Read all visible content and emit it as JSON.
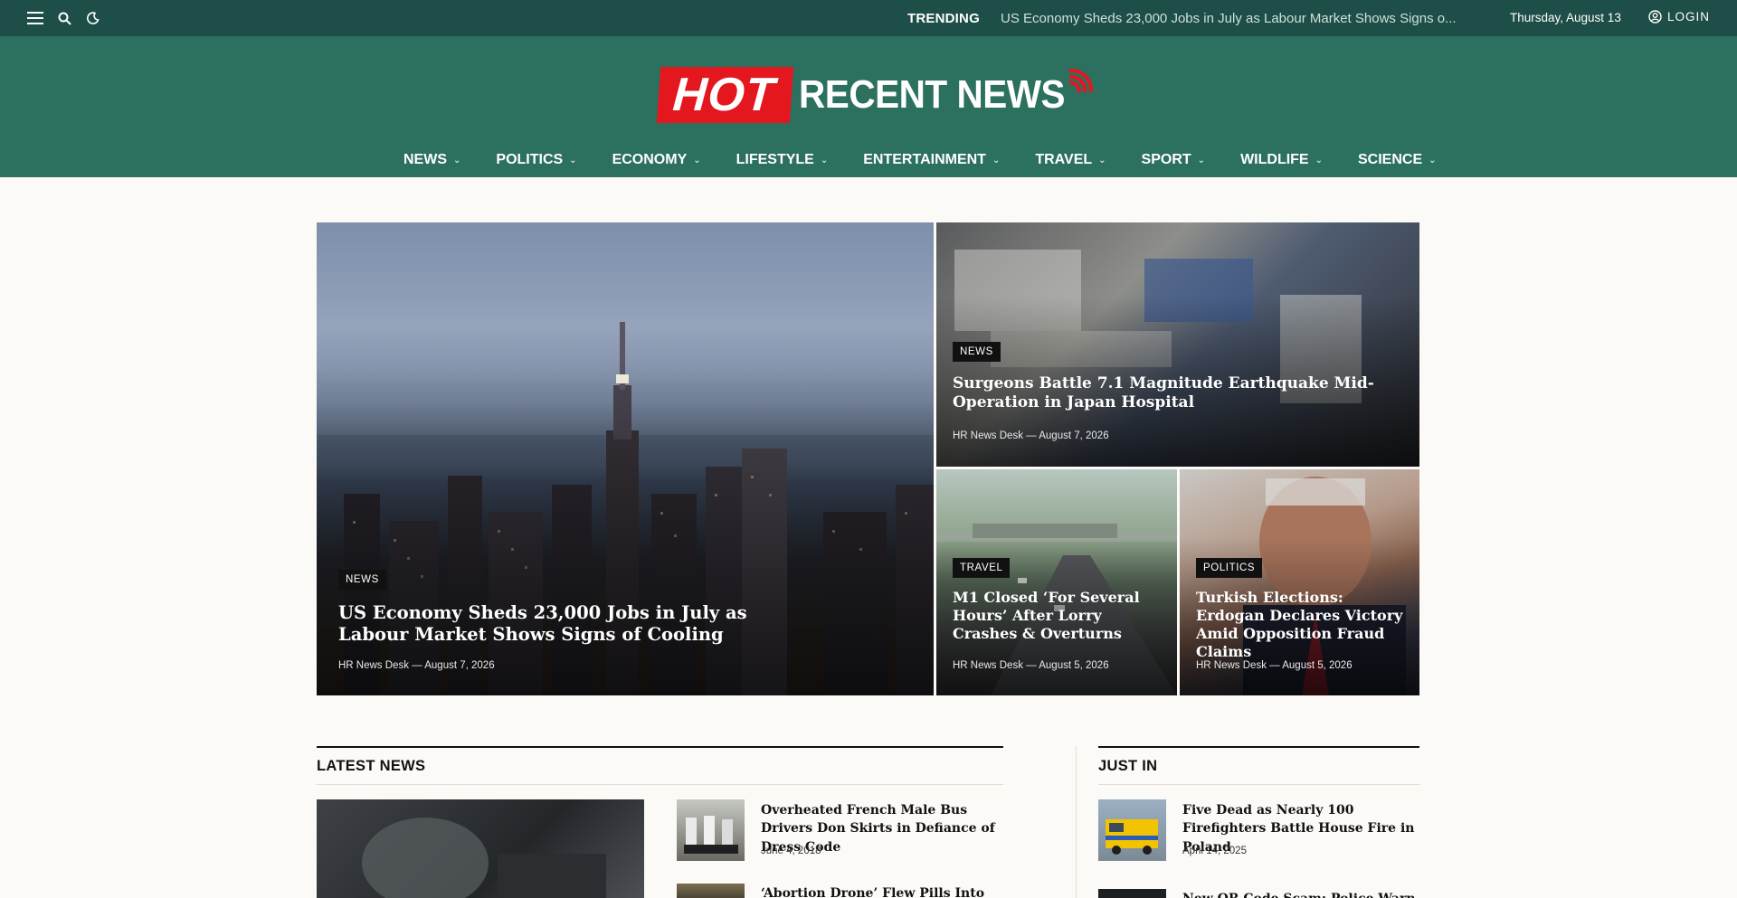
{
  "topbar": {
    "trending_label": "TRENDING",
    "trending_text": "US Economy Sheds 23,000 Jobs in July as Labour Market Shows Signs o...",
    "date": "Thursday, August 13",
    "login_label": "LOGIN"
  },
  "logo": {
    "hot": "HOT",
    "rest": "RECENT NEWS"
  },
  "nav": [
    "NEWS",
    "POLITICS",
    "ECONOMY",
    "LIFESTYLE",
    "ENTERTAINMENT",
    "TRAVEL",
    "SPORT",
    "WILDLIFE",
    "SCIENCE"
  ],
  "hero": {
    "main": {
      "category": "NEWS",
      "title": "US Economy Sheds 23,000 Jobs in July as Labour Market Shows Signs of Cooling",
      "author": "HR News Desk",
      "date": "August 7, 2026"
    },
    "top_right": {
      "category": "NEWS",
      "title": "Surgeons Battle 7.1 Magnitude Earthquake Mid-Operation in Japan Hospital",
      "author": "HR News Desk",
      "date": "August 7, 2026"
    },
    "bottom_left": {
      "category": "TRAVEL",
      "title": "M1 Closed ‘For Several Hours’ After Lorry Crashes & Overturns",
      "author": "HR News Desk",
      "date": "August 5, 2026"
    },
    "bottom_right": {
      "category": "POLITICS",
      "title": "Turkish Elections: Erdogan Declares Victory Amid Opposition Fraud Claims",
      "author": "HR News Desk",
      "date": "August 5, 2026"
    }
  },
  "latest": {
    "heading": "LATEST NEWS",
    "items": [
      {
        "title": "Overheated French Male Bus Drivers Don Skirts in Defiance of Dress Code",
        "date": "June 4, 2018"
      },
      {
        "title": "‘Abortion Drone’ Flew Pills Into Belfast to",
        "date": ""
      }
    ]
  },
  "just_in": {
    "heading": "JUST IN",
    "items": [
      {
        "title": "Five Dead as Nearly 100 Firefighters Battle House Fire in Poland",
        "date": "April 14, 2025"
      },
      {
        "title": "New QR Code Scam: Police Warn Public",
        "date": ""
      }
    ]
  },
  "meta_separator": "—",
  "colors": {
    "topbar": "#1d4e47",
    "header": "#2c7060",
    "brand_red": "#e5171e",
    "page_bg": "#fbfaf6"
  }
}
